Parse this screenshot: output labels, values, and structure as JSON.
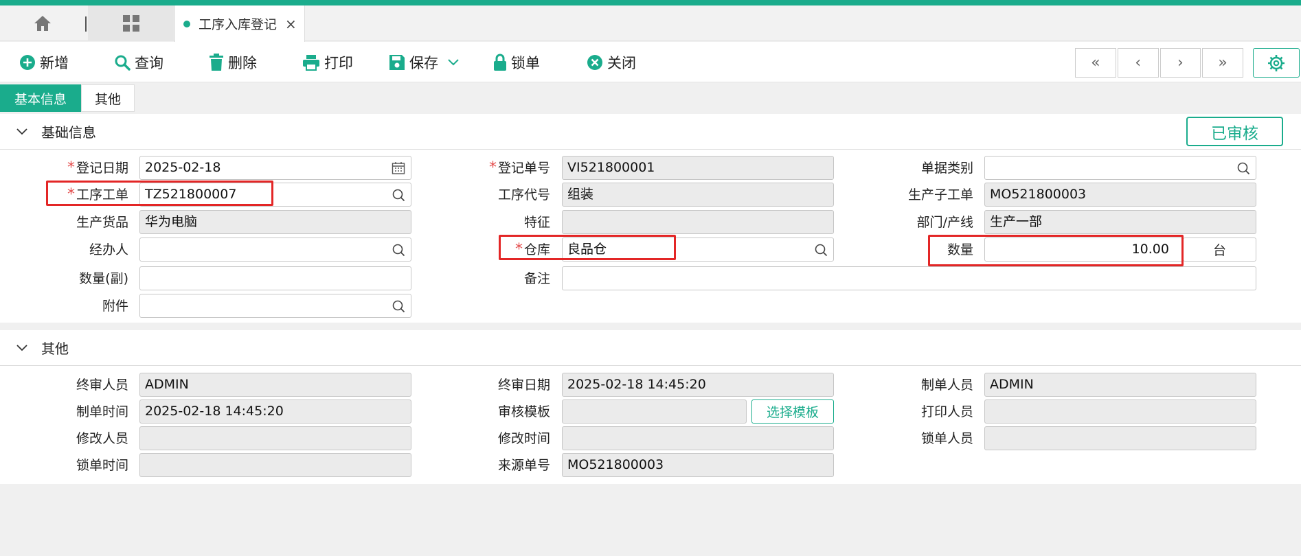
{
  "tabs": {
    "active_label": "工序入库登记",
    "close_glyph": "×"
  },
  "toolbar": {
    "add": "新增",
    "query": "查询",
    "delete": "删除",
    "print": "打印",
    "save": "保存",
    "lock": "锁单",
    "close": "关闭",
    "nav_first": "«",
    "nav_prev": "‹",
    "nav_next": "›",
    "nav_last": "»"
  },
  "subtabs": {
    "basic": "基本信息",
    "other": "其他"
  },
  "status_badge": "已审核",
  "basic": {
    "section_title": "基础信息",
    "reg_date_label": "登记日期",
    "reg_date": "2025-02-18",
    "reg_no_label": "登记单号",
    "reg_no": "VI521800001",
    "doc_type_label": "单据类别",
    "doc_type": "",
    "process_order_label": "工序工单",
    "process_order": "TZ521800007",
    "process_code_label": "工序代号",
    "process_code": "组装",
    "sub_order_label": "生产子工单",
    "sub_order": "MO521800003",
    "product_label": "生产货品",
    "product": "华为电脑",
    "feature_label": "特征",
    "feature": "",
    "dept_label": "部门/产线",
    "dept": "生产一部",
    "handler_label": "经办人",
    "handler": "",
    "warehouse_label": "仓库",
    "warehouse": "良品仓",
    "qty_label": "数量",
    "qty": "10.00",
    "unit": "台",
    "qty_sub_label": "数量(副)",
    "qty_sub": "",
    "remark_label": "备注",
    "remark": "",
    "attachment_label": "附件",
    "attachment": ""
  },
  "other": {
    "section_title": "其他",
    "final_reviewer_label": "终审人员",
    "final_reviewer": "ADMIN",
    "final_date_label": "终审日期",
    "final_date": "2025-02-18 14:45:20",
    "creator_label": "制单人员",
    "creator": "ADMIN",
    "create_time_label": "制单时间",
    "create_time": "2025-02-18 14:45:20",
    "review_tpl_label": "审核模板",
    "review_tpl": "",
    "select_tpl_button": "选择模板",
    "printer_label": "打印人员",
    "printer": "",
    "modifier_label": "修改人员",
    "modifier": "",
    "modify_time_label": "修改时间",
    "modify_time": "",
    "locker_label": "锁单人员",
    "locker": "",
    "lock_time_label": "锁单时间",
    "lock_time": "",
    "source_no_label": "来源单号",
    "source_no": "MO521800003"
  },
  "colors": {
    "accent": "#1aac8c",
    "highlight": "#e32626",
    "required": "#e34b4b"
  }
}
